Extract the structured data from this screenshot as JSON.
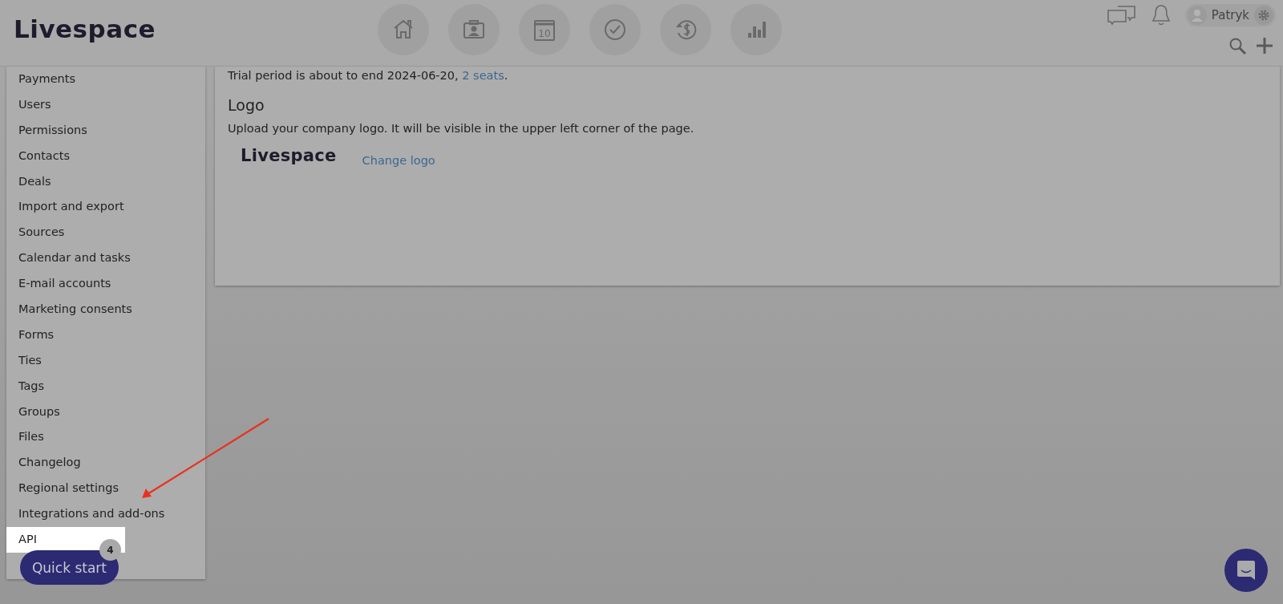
{
  "header": {
    "logo": "Livespace",
    "nav": [
      {
        "kind": "home"
      },
      {
        "kind": "contacts"
      },
      {
        "kind": "calendar",
        "text": "10"
      },
      {
        "kind": "tasks"
      },
      {
        "kind": "deals"
      },
      {
        "kind": "reports"
      }
    ],
    "user": {
      "name": "Patryk"
    }
  },
  "sidebar": {
    "items": [
      {
        "label": "Payments",
        "selected": false
      },
      {
        "label": "Users",
        "selected": false
      },
      {
        "label": "Permissions",
        "selected": false
      },
      {
        "label": "Contacts",
        "selected": false
      },
      {
        "label": "Deals",
        "selected": false
      },
      {
        "label": "Import and export",
        "selected": false
      },
      {
        "label": "Sources",
        "selected": false
      },
      {
        "label": "Calendar and tasks",
        "selected": false
      },
      {
        "label": "E-mail accounts",
        "selected": false
      },
      {
        "label": "Marketing consents",
        "selected": false
      },
      {
        "label": "Forms",
        "selected": false
      },
      {
        "label": "Ties",
        "selected": false
      },
      {
        "label": "Tags",
        "selected": false
      },
      {
        "label": "Groups",
        "selected": false
      },
      {
        "label": "Files",
        "selected": false
      },
      {
        "label": "Changelog",
        "selected": false
      },
      {
        "label": "Regional settings",
        "selected": false
      },
      {
        "label": "Integrations and add-ons",
        "selected": false
      },
      {
        "label": "API",
        "selected": true
      }
    ]
  },
  "content": {
    "trial_notice": {
      "text": "Trial period is about to end 2024-06-20, ",
      "link": "2 seats",
      "suffix": "."
    },
    "logo_section": {
      "heading": "Logo",
      "description": "Upload your company logo. It will be visible in the upper left corner of the page.",
      "logo": "Livespace",
      "change_link": "Change logo"
    }
  },
  "quick_start": {
    "label": "Quick start",
    "badge": "4"
  }
}
